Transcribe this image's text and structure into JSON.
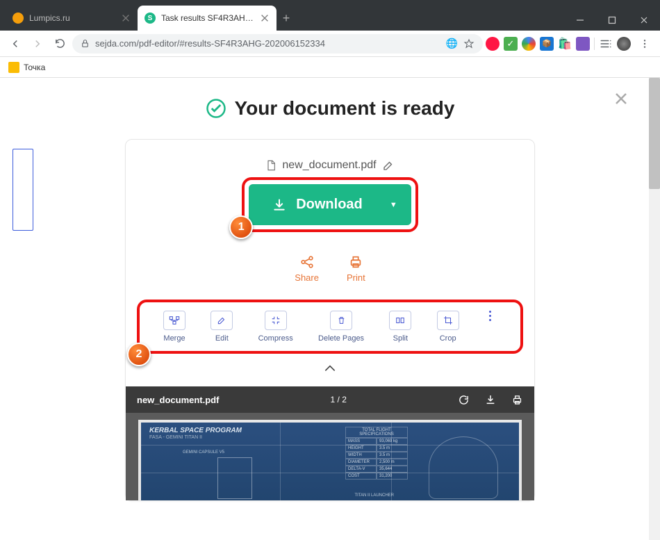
{
  "browser": {
    "tabs": [
      {
        "title": "Lumpics.ru",
        "active": false
      },
      {
        "title": "Task results SF4R3AHG-202006152334",
        "active": true
      }
    ],
    "url_display": "sejda.com/pdf-editor/#results-SF4R3AHG-202006152334",
    "bookmark_label": "Точка"
  },
  "page": {
    "heading": "Your document is ready",
    "filename": "new_document.pdf",
    "download_label": "Download",
    "share_print": {
      "share": "Share",
      "print": "Print"
    },
    "tools": [
      {
        "label": "Merge"
      },
      {
        "label": "Edit"
      },
      {
        "label": "Compress"
      },
      {
        "label": "Delete Pages"
      },
      {
        "label": "Split"
      },
      {
        "label": "Crop"
      }
    ],
    "preview": {
      "filename": "new_document.pdf",
      "page_indicator": "1 / 2",
      "doc_title": "KERBAL SPACE PROGRAM",
      "doc_subtitle": "FASA - GEMINI TITAN II",
      "table_header": "TOTAL FLIGHT SPECIFICATIONS",
      "rows": [
        [
          "MASS",
          "93,069 kg"
        ],
        [
          "HEIGHT",
          "3.5 m"
        ],
        [
          "WIDTH",
          "3.5 m"
        ],
        [
          "DIAMETER",
          "2,500 m"
        ],
        [
          "DELTA-V",
          "35,644"
        ],
        [
          "COST",
          "31,200"
        ]
      ],
      "label_capsule": "GEMINI CAPSULE V5",
      "label_launcher": "TITAN II LAUNCHER"
    }
  },
  "annotations": {
    "badge1": "1",
    "badge2": "2"
  }
}
